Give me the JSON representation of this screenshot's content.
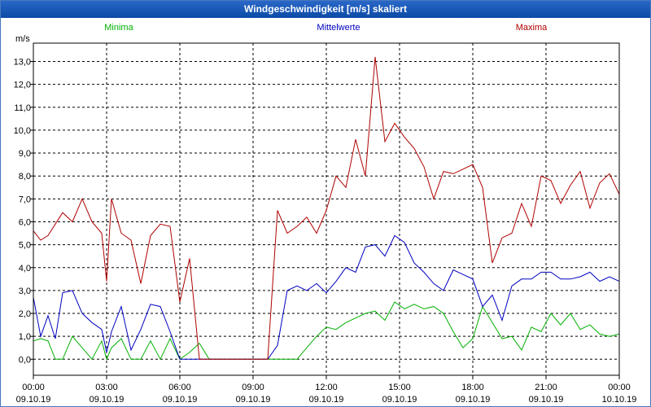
{
  "window": {
    "title": "Windgeschwindigkeit [m/s] skaliert"
  },
  "colors": {
    "min": "#00b000",
    "mean": "#0000c0",
    "max": "#b00000",
    "grid": "#000000",
    "text": "#000000"
  },
  "chart_data": {
    "type": "line",
    "title": "Windgeschwindigkeit [m/s] skaliert",
    "ylabel": "m/s",
    "xlabel": "",
    "ylim": [
      -0.7,
      13.8
    ],
    "xlim": [
      0,
      24
    ],
    "yticks": [
      "0,0",
      "1,0",
      "2,0",
      "3,0",
      "4,0",
      "5,0",
      "6,0",
      "7,0",
      "8,0",
      "9,0",
      "10,0",
      "11,0",
      "12,0",
      "13,0"
    ],
    "xticks": [
      {
        "time": "00:00",
        "date": "09.10.19"
      },
      {
        "time": "03:00",
        "date": "09.10.19"
      },
      {
        "time": "06:00",
        "date": "09.10.19"
      },
      {
        "time": "09:00",
        "date": "09.10.19"
      },
      {
        "time": "12:00",
        "date": "09.10.19"
      },
      {
        "time": "15:00",
        "date": "09.10.19"
      },
      {
        "time": "18:00",
        "date": "09.10.19"
      },
      {
        "time": "21:00",
        "date": "09.10.19"
      },
      {
        "time": "00:00",
        "date": "10.10.19"
      }
    ],
    "grid": true,
    "series": [
      {
        "name": "Minima",
        "x": [
          0,
          0.3,
          0.6,
          0.9,
          1.2,
          1.6,
          2.0,
          2.4,
          2.8,
          3.0,
          3.2,
          3.6,
          4.0,
          4.4,
          4.8,
          5.2,
          5.6,
          6.0,
          6.4,
          6.8,
          7.2,
          7.6,
          8.0,
          8.4,
          8.8,
          9.2,
          9.6,
          10.0,
          10.4,
          10.8,
          11.2,
          11.6,
          12.0,
          12.4,
          12.8,
          13.2,
          13.6,
          14.0,
          14.4,
          14.8,
          15.2,
          15.6,
          16.0,
          16.4,
          16.8,
          17.2,
          17.6,
          18.0,
          18.4,
          18.8,
          19.2,
          19.6,
          20.0,
          20.4,
          20.8,
          21.2,
          21.6,
          22.0,
          22.4,
          22.8,
          23.2,
          23.6,
          24.0
        ],
        "values": [
          0.8,
          0.9,
          0.8,
          0.0,
          0.0,
          1.0,
          0.5,
          0.0,
          0.8,
          0.0,
          0.5,
          0.9,
          0.0,
          0.0,
          0.8,
          0.0,
          0.9,
          0.0,
          0.3,
          0.7,
          0.0,
          0.0,
          0.0,
          0.0,
          0.0,
          0.0,
          0.0,
          0.0,
          0.0,
          0.0,
          0.5,
          1.0,
          1.4,
          1.3,
          1.6,
          1.8,
          2.0,
          2.1,
          1.7,
          2.5,
          2.2,
          2.4,
          2.2,
          2.3,
          2.0,
          1.2,
          0.5,
          0.9,
          2.3,
          1.6,
          0.9,
          1.0,
          0.4,
          1.4,
          1.2,
          2.0,
          1.5,
          2.0,
          1.3,
          1.5,
          1.1,
          1.0,
          1.1
        ]
      },
      {
        "name": "Mittelwerte",
        "x": [
          0,
          0.3,
          0.6,
          0.9,
          1.2,
          1.6,
          2.0,
          2.4,
          2.8,
          3.0,
          3.2,
          3.6,
          4.0,
          4.4,
          4.8,
          5.2,
          5.6,
          6.0,
          6.4,
          6.8,
          7.2,
          7.6,
          8.0,
          8.4,
          8.8,
          9.2,
          9.6,
          10.0,
          10.4,
          10.8,
          11.2,
          11.6,
          12.0,
          12.4,
          12.8,
          13.2,
          13.6,
          14.0,
          14.4,
          14.8,
          15.2,
          15.6,
          16.0,
          16.4,
          16.8,
          17.2,
          17.6,
          18.0,
          18.4,
          18.8,
          19.2,
          19.6,
          20.0,
          20.4,
          20.8,
          21.2,
          21.6,
          22.0,
          22.4,
          22.8,
          23.2,
          23.6,
          24.0
        ],
        "values": [
          2.7,
          1.0,
          1.9,
          0.9,
          2.9,
          3.0,
          2.0,
          1.6,
          1.3,
          0.3,
          1.2,
          2.3,
          0.4,
          1.3,
          2.4,
          2.3,
          1.2,
          0.0,
          0.0,
          0.0,
          0.0,
          0.0,
          0.0,
          0.0,
          0.0,
          0.0,
          0.0,
          0.6,
          3.0,
          3.2,
          3.0,
          3.3,
          2.9,
          3.4,
          4.0,
          3.8,
          4.9,
          5.0,
          4.5,
          5.4,
          5.1,
          4.2,
          3.8,
          3.3,
          3.0,
          3.9,
          3.7,
          3.5,
          2.3,
          2.8,
          1.7,
          3.2,
          3.5,
          3.5,
          3.8,
          3.8,
          3.5,
          3.5,
          3.6,
          3.8,
          3.4,
          3.6,
          3.4
        ]
      },
      {
        "name": "Maxima",
        "x": [
          0,
          0.3,
          0.6,
          0.9,
          1.2,
          1.6,
          2.0,
          2.4,
          2.8,
          3.0,
          3.2,
          3.6,
          4.0,
          4.4,
          4.8,
          5.2,
          5.6,
          6.0,
          6.4,
          6.8,
          7.2,
          7.6,
          8.0,
          8.4,
          8.8,
          9.2,
          9.6,
          10.0,
          10.4,
          10.8,
          11.2,
          11.6,
          12.0,
          12.4,
          12.8,
          13.2,
          13.6,
          14.0,
          14.4,
          14.8,
          15.2,
          15.6,
          16.0,
          16.4,
          16.8,
          17.2,
          17.6,
          18.0,
          18.4,
          18.8,
          19.2,
          19.6,
          20.0,
          20.4,
          20.8,
          21.2,
          21.6,
          22.0,
          22.4,
          22.8,
          23.2,
          23.6,
          24.0
        ],
        "values": [
          5.6,
          5.2,
          5.4,
          5.9,
          6.4,
          6.0,
          7.0,
          6.0,
          5.5,
          3.4,
          7.0,
          5.5,
          5.2,
          3.3,
          5.4,
          5.9,
          5.8,
          2.5,
          4.4,
          0.0,
          0.0,
          0.0,
          0.0,
          0.0,
          0.0,
          0.0,
          0.0,
          6.5,
          5.5,
          5.8,
          6.2,
          5.5,
          6.5,
          8.0,
          7.5,
          9.6,
          8.0,
          13.2,
          9.5,
          10.3,
          9.7,
          9.2,
          8.4,
          7.0,
          8.2,
          8.1,
          8.3,
          8.5,
          7.5,
          4.2,
          5.3,
          5.5,
          6.8,
          5.8,
          8.0,
          7.8,
          6.8,
          7.6,
          8.2,
          6.6,
          7.7,
          8.1,
          7.2
        ]
      }
    ]
  }
}
